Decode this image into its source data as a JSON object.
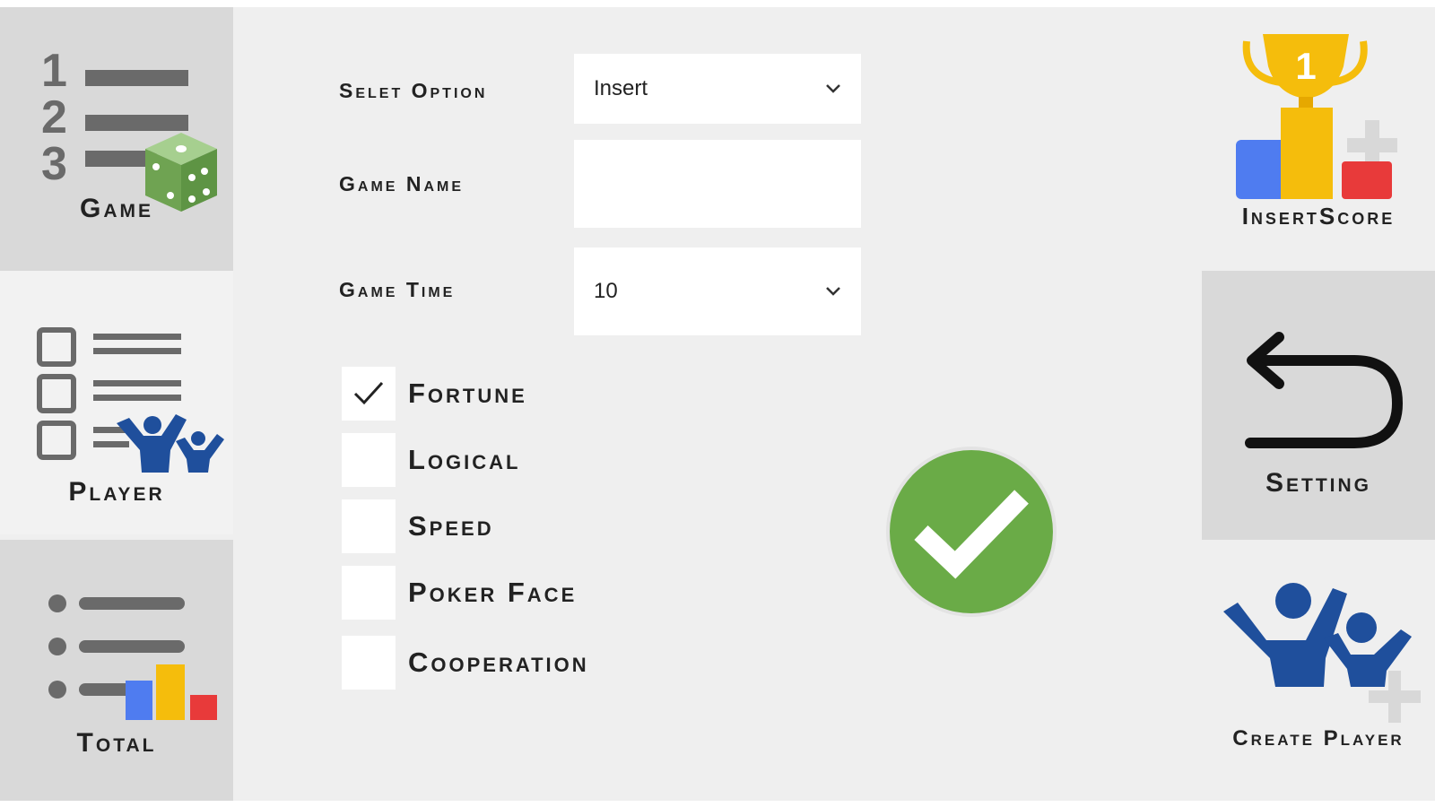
{
  "sidebar_left": {
    "game": {
      "label": "Game",
      "icon": "game-list-dice-icon",
      "numbers": [
        "1",
        "2",
        "3"
      ]
    },
    "player": {
      "label": "Player",
      "icon": "player-list-icon"
    },
    "total": {
      "label": "Total",
      "icon": "total-chart-icon"
    }
  },
  "sidebar_right": {
    "insert_score": {
      "label": "InsertScore",
      "icon": "trophy-icon",
      "trophy_number": "1"
    },
    "setting": {
      "label": "Setting",
      "icon": "back-arrow-icon"
    },
    "create_player": {
      "label": "Create Player",
      "icon": "add-player-icon"
    }
  },
  "form": {
    "select_option": {
      "label": "Selet Option",
      "value": "Insert"
    },
    "game_name": {
      "label": "Game Name",
      "value": ""
    },
    "game_time": {
      "label": "Game Time",
      "value": "10"
    },
    "categories": [
      {
        "label": "Fortune",
        "checked": true
      },
      {
        "label": "Logical",
        "checked": false
      },
      {
        "label": "Speed",
        "checked": false
      },
      {
        "label": "Poker Face",
        "checked": false
      },
      {
        "label": "Cooperation",
        "checked": false
      }
    ]
  },
  "colors": {
    "green": "#6aab47",
    "blue": "#4f7cf0",
    "yellow": "#f5bd0c",
    "red": "#e83a3a",
    "people_blue": "#1f4f9c",
    "dice_green": "#7fb069"
  }
}
